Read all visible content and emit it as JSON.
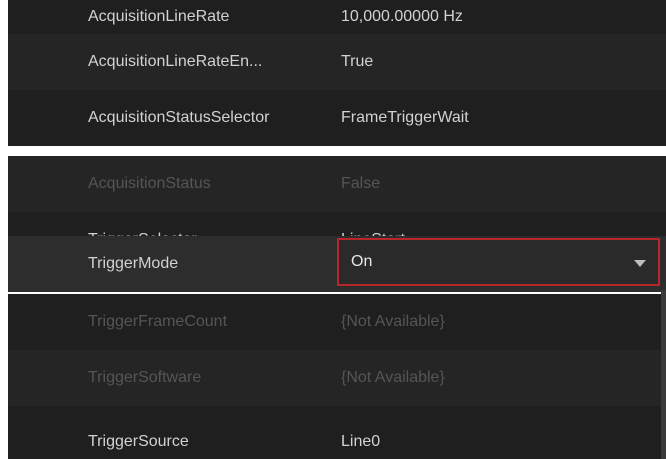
{
  "properties": [
    {
      "name": "AcquisitionLineRate",
      "value": "10,000.00000 Hz",
      "state": "normal"
    },
    {
      "name": "AcquisitionLineRateEn...",
      "value": "True",
      "state": "normal"
    },
    {
      "name": "AcquisitionStatusSelector",
      "value": "FrameTriggerWait",
      "state": "normal"
    },
    {
      "name": "AcquisitionStatus",
      "value": "False",
      "state": "disabled"
    },
    {
      "name": "TriggerSelector",
      "value": "LineStart",
      "state": "normal"
    },
    {
      "name": "TriggerMode",
      "value": "On",
      "state": "selected"
    },
    {
      "name": "TriggerFrameCount",
      "value": "{Not Available}",
      "state": "disabled"
    },
    {
      "name": "TriggerSoftware",
      "value": "{Not Available}",
      "state": "disabled"
    },
    {
      "name": "TriggerSource",
      "value": "Line0",
      "state": "normal"
    }
  ],
  "selected_editor": {
    "value": "On",
    "icon": "chevron-down-icon"
  },
  "colors": {
    "background_even": "#1f1f1f",
    "background_odd": "#252525",
    "text": "#d2d2d2",
    "disabled_text": "#555555",
    "selection_border": "#b8262a"
  }
}
